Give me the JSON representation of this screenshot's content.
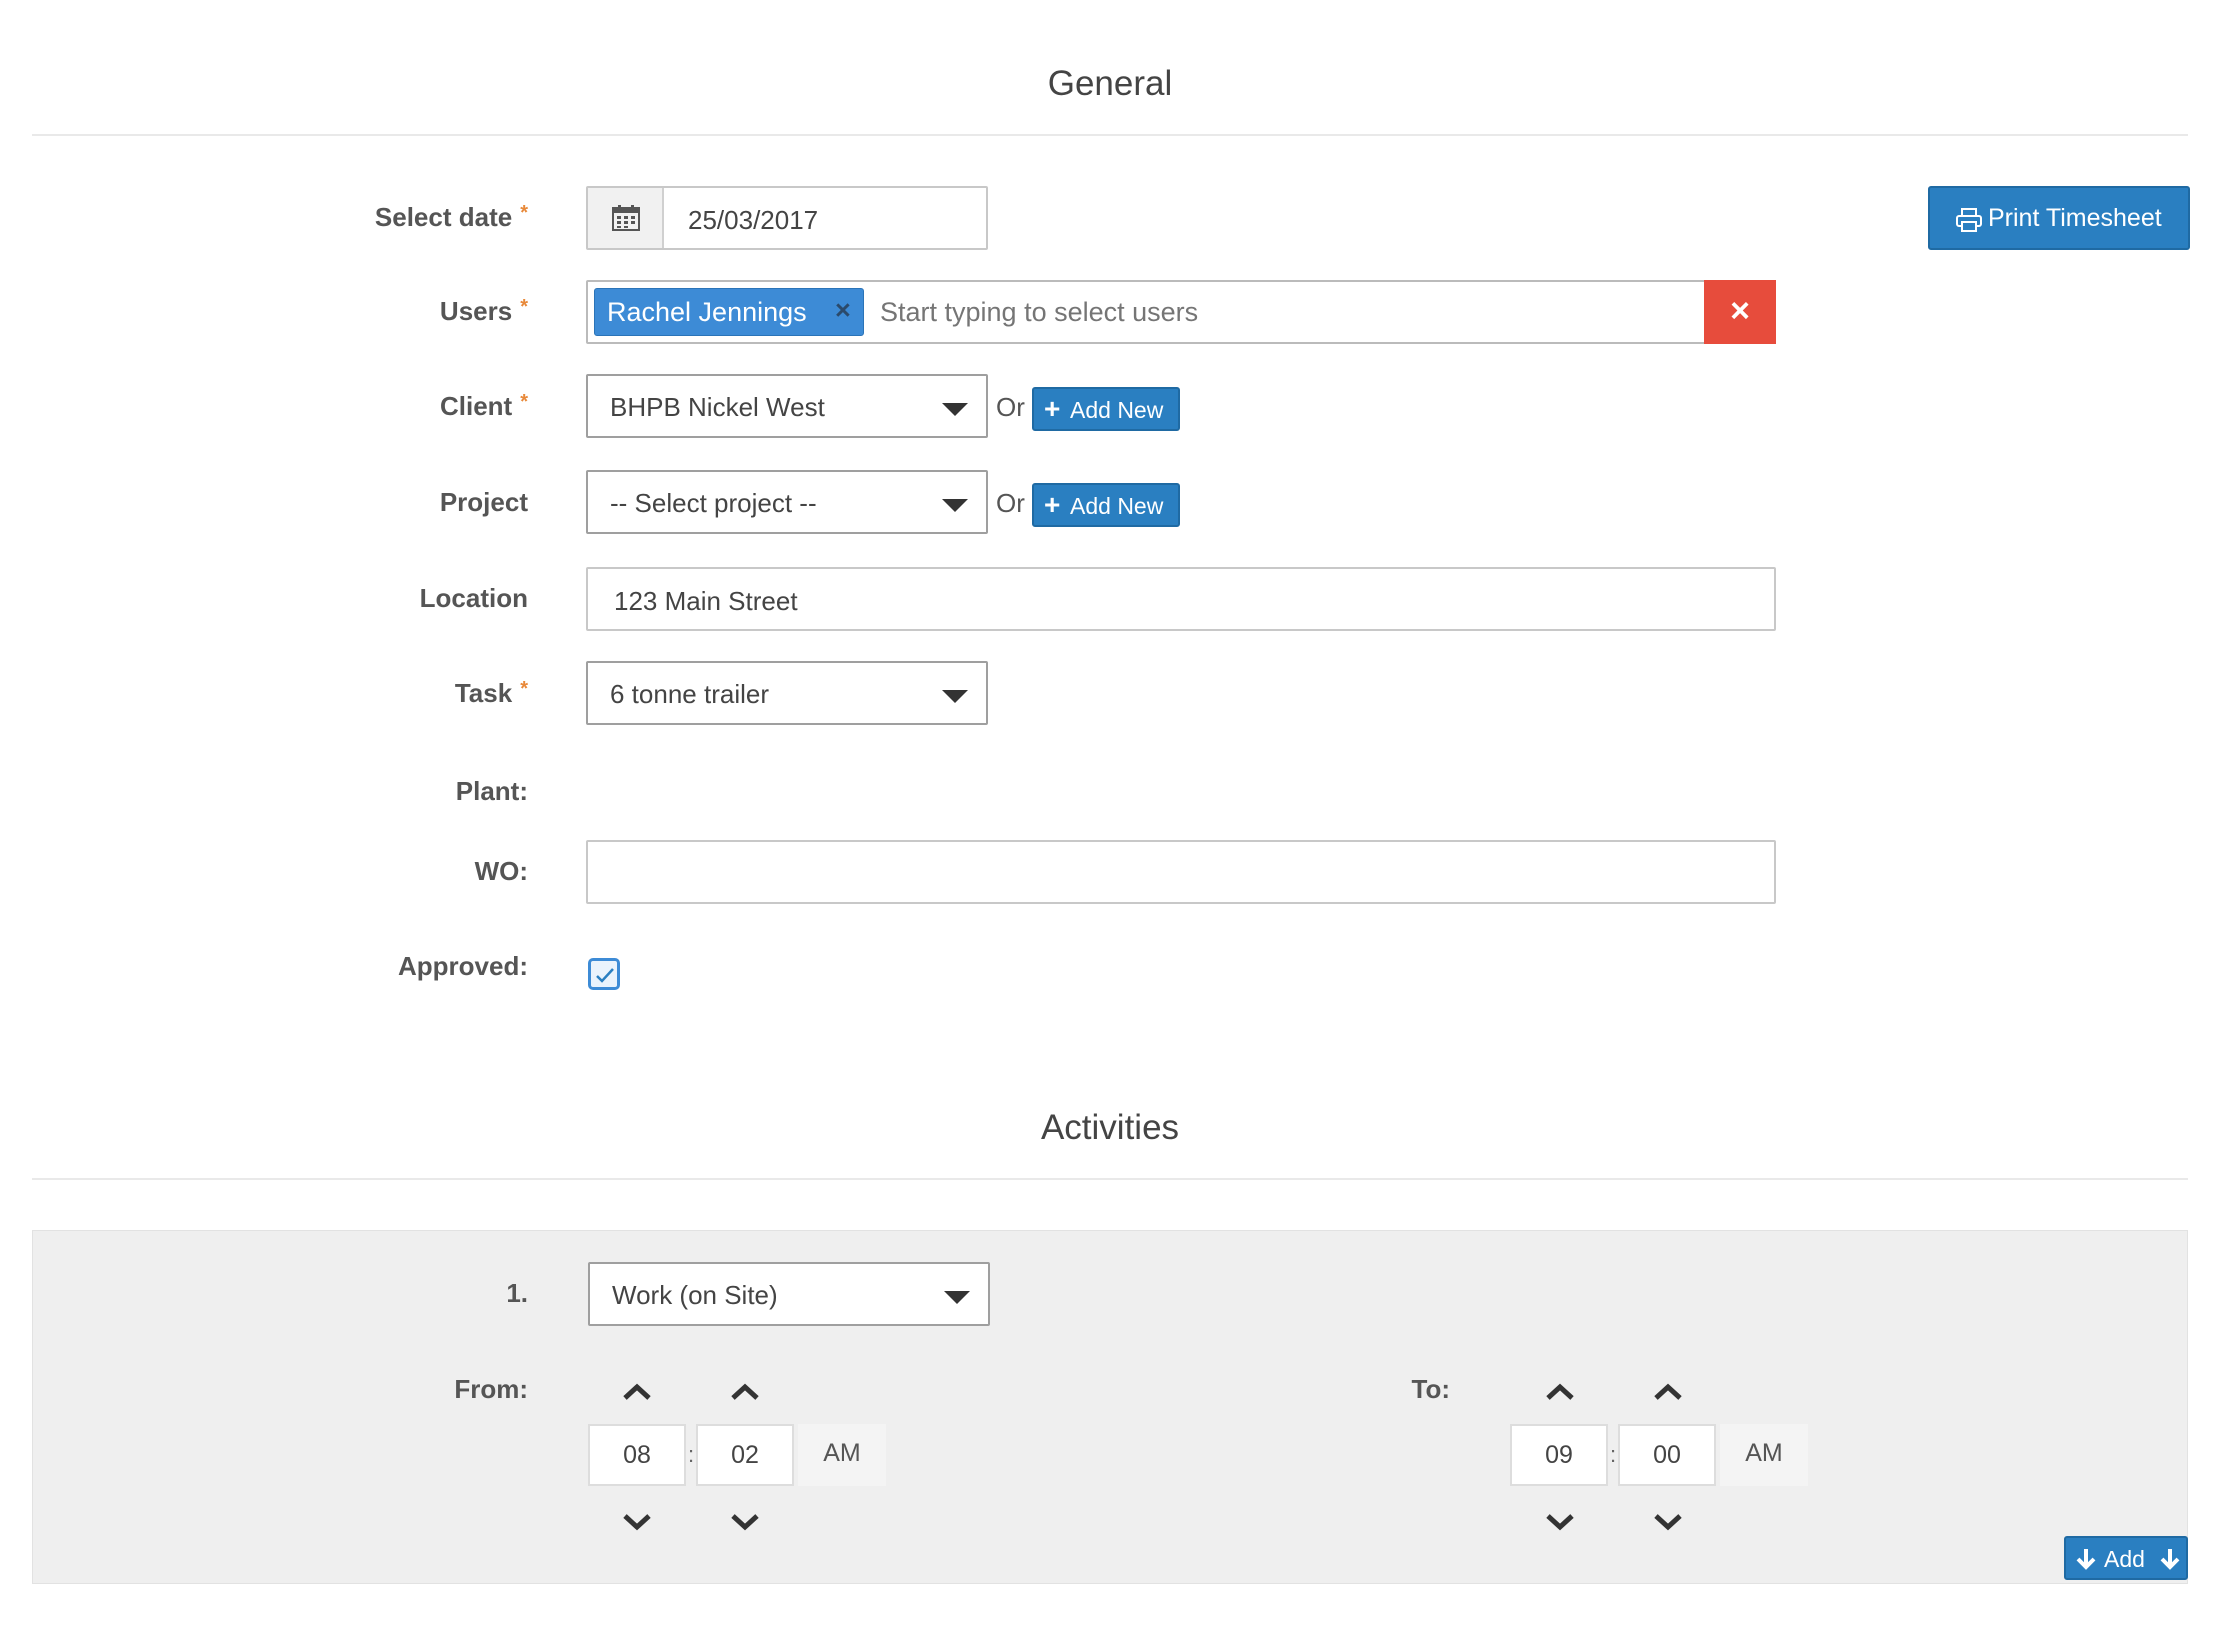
{
  "general": {
    "title": "General",
    "fields": {
      "date": {
        "label": "Select date",
        "required_mark": "*",
        "value": "25/03/2017"
      },
      "users": {
        "label": "Users",
        "required_mark": "*",
        "selected_tag": "Rachel Jennings",
        "tag_remove": "×",
        "placeholder": "Start typing to select users",
        "clear_icon": "×"
      },
      "client": {
        "label": "Client",
        "required_mark": "*",
        "value": "BHPB Nickel West",
        "or": "Or",
        "add_new": "Add New"
      },
      "project": {
        "label": "Project",
        "value": "-- Select project --",
        "or": "Or",
        "add_new": "Add New"
      },
      "location": {
        "label": "Location",
        "value": "123 Main Street"
      },
      "task": {
        "label": "Task",
        "required_mark": "*",
        "value": "6 tonne trailer"
      },
      "plant": {
        "label": "Plant:"
      },
      "wo": {
        "label": "WO:",
        "value": ""
      },
      "approved": {
        "label": "Approved:",
        "checked": true
      }
    },
    "print_button": "Print Timesheet"
  },
  "activities": {
    "title": "Activities",
    "items": [
      {
        "index": "1.",
        "type": "Work (on Site)",
        "from_label": "From:",
        "from": {
          "hour": "08",
          "minute": "02",
          "meridian": "AM"
        },
        "to_label": "To:",
        "to": {
          "hour": "09",
          "minute": "00",
          "meridian": "AM"
        },
        "separator": ":"
      }
    ],
    "add_button": "Add"
  },
  "colors": {
    "primary": "#2a7fc1",
    "danger": "#e74c3c",
    "required": "#e8893a",
    "panel_bg": "#efefef"
  }
}
